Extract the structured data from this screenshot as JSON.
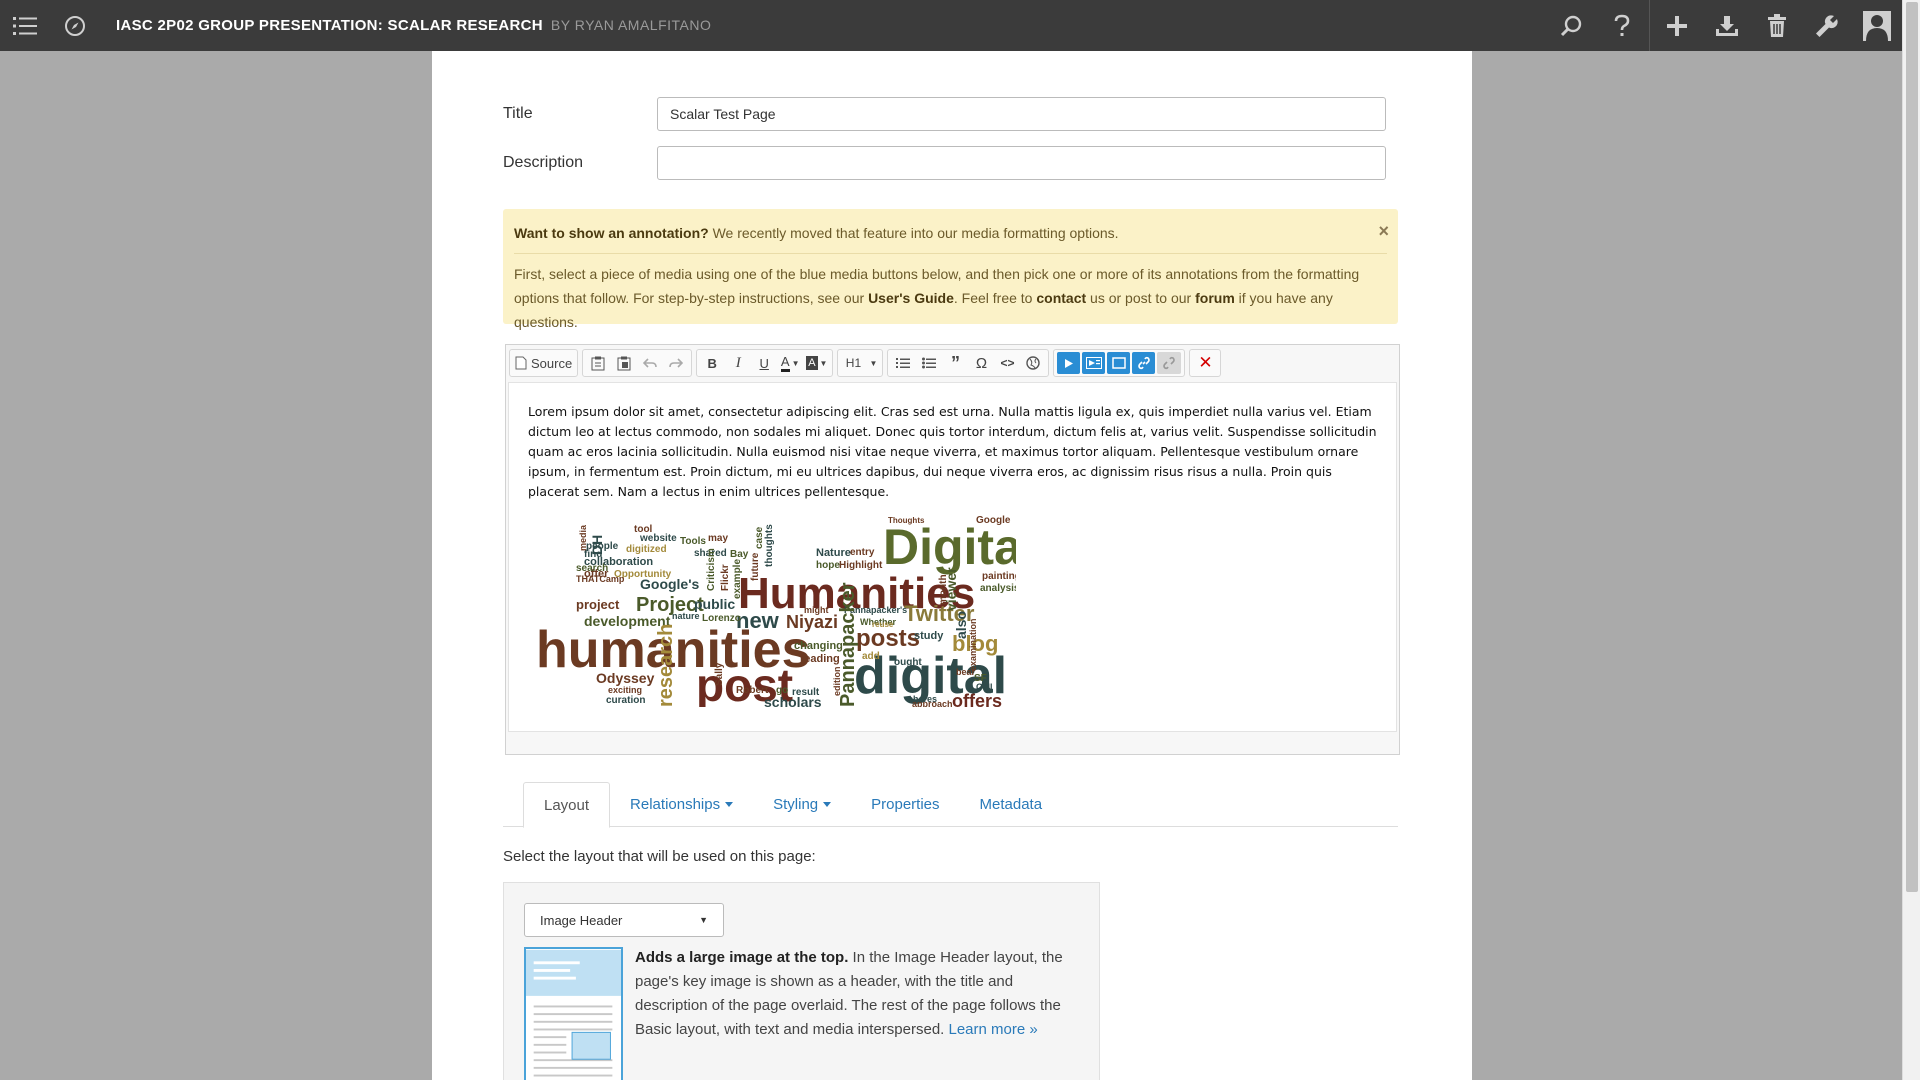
{
  "topbar": {
    "book_title": "IASC 2P02 GROUP PRESENTATION: SCALAR RESEARCH",
    "byline": "BY RYAN AMALFITANO",
    "icons": [
      "menu-icon",
      "compass-icon",
      "search-icon",
      "help-icon",
      "plus-icon",
      "download-icon",
      "trash-icon",
      "wrench-icon",
      "user-icon"
    ]
  },
  "form": {
    "title_label": "Title",
    "title_value": "Scalar Test Page",
    "description_label": "Description",
    "description_value": ""
  },
  "alert": {
    "heading": "Want to show an annotation?",
    "heading_rest": " We recently moved that feature into our media formatting options.",
    "close": "×",
    "body_1": "First, select a piece of media using one of the blue media buttons below, and then pick one or more of its annotations from the formatting options that follow. For step-by-step instructions, see our ",
    "users_guide": "User's Guide",
    "body_2": ". Feel free to ",
    "contact": "contact",
    "body_3": " us or post to our ",
    "forum": "forum",
    "body_4": " if you have any questions."
  },
  "editor": {
    "source_label": "Source",
    "format_label": "H1",
    "body_text": "Lorem ipsum dolor sit amet, consectetur adipiscing elit. Cras sed est urna. Nulla mattis ligula ex, quis imperdiet nulla varius vel. Etiam dictum leo at lectus commodo, non sodales mi aliquet. Donec quis tortor interdum, dictum felis at, varius velit. Suspendisse sollicitudin quam ac eros lacinia sollicitudin. Nulla euismod nisi vitae neque viverra, et maximus tortor aliquam. Pellentesque vestibulum ornare ipsum, in fermentum est. Proin dictum, mi eu ultrices dapibus, dui neque viverra eros, ac dignissim risus risus a nulla. Proin quis placerat sem. Nam a lectus in enim ultrices pellentesque.",
    "wordcloud_words": [
      "Digital",
      "Humanities",
      "humanities",
      "post",
      "digital",
      "posts",
      "Twitter",
      "blog",
      "Project",
      "new",
      "Niyazi",
      "development",
      "public",
      "Google's",
      "offers",
      "scholars",
      "Odyssey",
      "changing",
      "reading",
      "study",
      "painting",
      "analysis",
      "Google",
      "Nature",
      "hope",
      "Highlight",
      "entry",
      "collaboration",
      "offer",
      "Opportunity",
      "website",
      "Tools",
      "may",
      "shared",
      "Bay",
      "tool",
      "people",
      "digitized",
      "project",
      "find",
      "search",
      "THATCamp",
      "DH",
      "Lorenzo",
      "Pannapacker's",
      "Whether",
      "might",
      "nature",
      "shares",
      "bear",
      "Call",
      "SF",
      "examination",
      "also",
      "Robert",
      "go",
      "result",
      "curation",
      "exciting",
      "Sally",
      "media",
      "Criticism",
      "Flickr",
      "example",
      "future",
      "thoughts",
      "case",
      "reuse",
      "add",
      "research",
      "ought",
      "viewer",
      "month",
      "Thoughts",
      "approach",
      "edition",
      "Pannapacker"
    ]
  },
  "tabs": {
    "layout": "Layout",
    "relationships": "Relationships",
    "styling": "Styling",
    "properties": "Properties",
    "metadata": "Metadata"
  },
  "layout": {
    "prompt": "Select the layout that will be used on this page:",
    "selected": "Image Header",
    "desc_bold": "Adds a large image at the top.",
    "desc_rest": " In the Image Header layout, the page's key image is shown as a header, with the title and description of the page overlaid. The rest of the page follows the Basic layout, with text and media interspersed. ",
    "learn_more": "Learn more »"
  },
  "colors": {
    "topbar": "#3b3b3b",
    "accent": "#2a7ab9",
    "alert_bg": "#fbf2c8",
    "media_button": "#2a8dd4",
    "background": "#aaaaaa"
  }
}
